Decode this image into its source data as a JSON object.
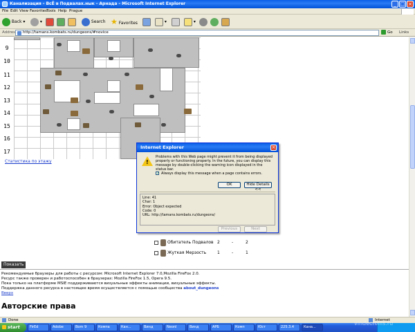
{
  "window": {
    "title": "Канализация - ВсЁ в Подвалах.нык - Арнада - Microsoft Internet Explorer"
  },
  "menu": [
    "File",
    "Edit",
    "View",
    "Favorites",
    "Tools",
    "Help",
    "Prague"
  ],
  "toolbar": {
    "back": "Back",
    "search": "Search",
    "favorites": "Favorites"
  },
  "address": {
    "label": "Address",
    "url": "http://tamans.kombats.ru/dungeons/#novice",
    "go": "Go",
    "links": "Links"
  },
  "map": {
    "rows": [
      "9",
      "10",
      "11",
      "12",
      "13",
      "14",
      "15",
      "16",
      "17"
    ]
  },
  "stats_link": "Статистика по этажу",
  "monsters": [
    {
      "name": "Обитатель Подвалов",
      "count": "2",
      "dash": "-",
      "total": "2"
    },
    {
      "name": "Жуткая Мерзость",
      "count": "1",
      "dash": "-",
      "total": "1"
    }
  ],
  "show_button": "Показать",
  "notes": {
    "line1": "Рекомендуемые браузеры для работы с ресурсом: Microsoft Internet Explorer 7.0,Mozilla FireFox 2.0.",
    "line2": "Ресурс также проверен и работоспособен в браузерах: Mozilla FireFox 1.5, Opera 9.5.",
    "line3": "Пока только на платформе MSIE поддерживаются визуальные эффекты анимации, визуальные эффекты.",
    "line4_prefix": "Поддержка данного ресурса в настоящее время осуществляется с помощью сообщества",
    "line4_link": "about_dungeons",
    "line5": "Вверх"
  },
  "copyright_heading": "Авторские права",
  "dialog": {
    "title": "Internet Explorer",
    "message": "Problems with this Web page might prevent it from being displayed properly or functioning properly. In the future, you can display this message by double-clicking the warning icon displayed in the status bar.",
    "checkbox_label": "Always display this message when a page contains errors.",
    "ok": "OK",
    "hide_details": "Hide Details <<",
    "details": {
      "line": "Line:  41",
      "char": "Char:  1",
      "error": "Error:  Object expected",
      "code": "Code:  0",
      "url": "URL:  http://tamans.kombats.ru/dungeons/"
    },
    "previous": "Previous",
    "next": "Next"
  },
  "status": {
    "text": "Done",
    "zone": "Internet"
  },
  "taskbar": {
    "start": "start",
    "tasks": [
      "FirEd",
      "Adobe",
      "Bom 9",
      "Компа",
      "Кан...",
      "Винд",
      "Neonl",
      "Винд",
      "АРБ",
      "Комп",
      "Юст",
      "225.3.4",
      "Кана..."
    ]
  },
  "watermark": "vindecroills.ru"
}
